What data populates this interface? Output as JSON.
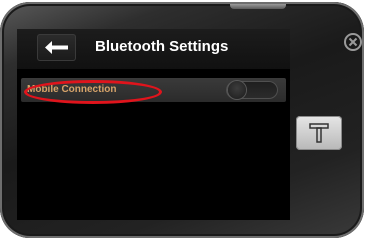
{
  "header": {
    "title": "Bluetooth Settings",
    "back_icon": "arrow-left-icon"
  },
  "settings": {
    "items": [
      {
        "label": "Mobile Connection",
        "toggle_state": "off",
        "highlighted": true
      }
    ]
  },
  "device": {
    "close_icon": "circle-x-icon",
    "side_button_icon": "t-shape-icon"
  },
  "colors": {
    "label_text": "#d7a46a",
    "highlight": "#e0141c",
    "title_text": "#ffffff"
  }
}
